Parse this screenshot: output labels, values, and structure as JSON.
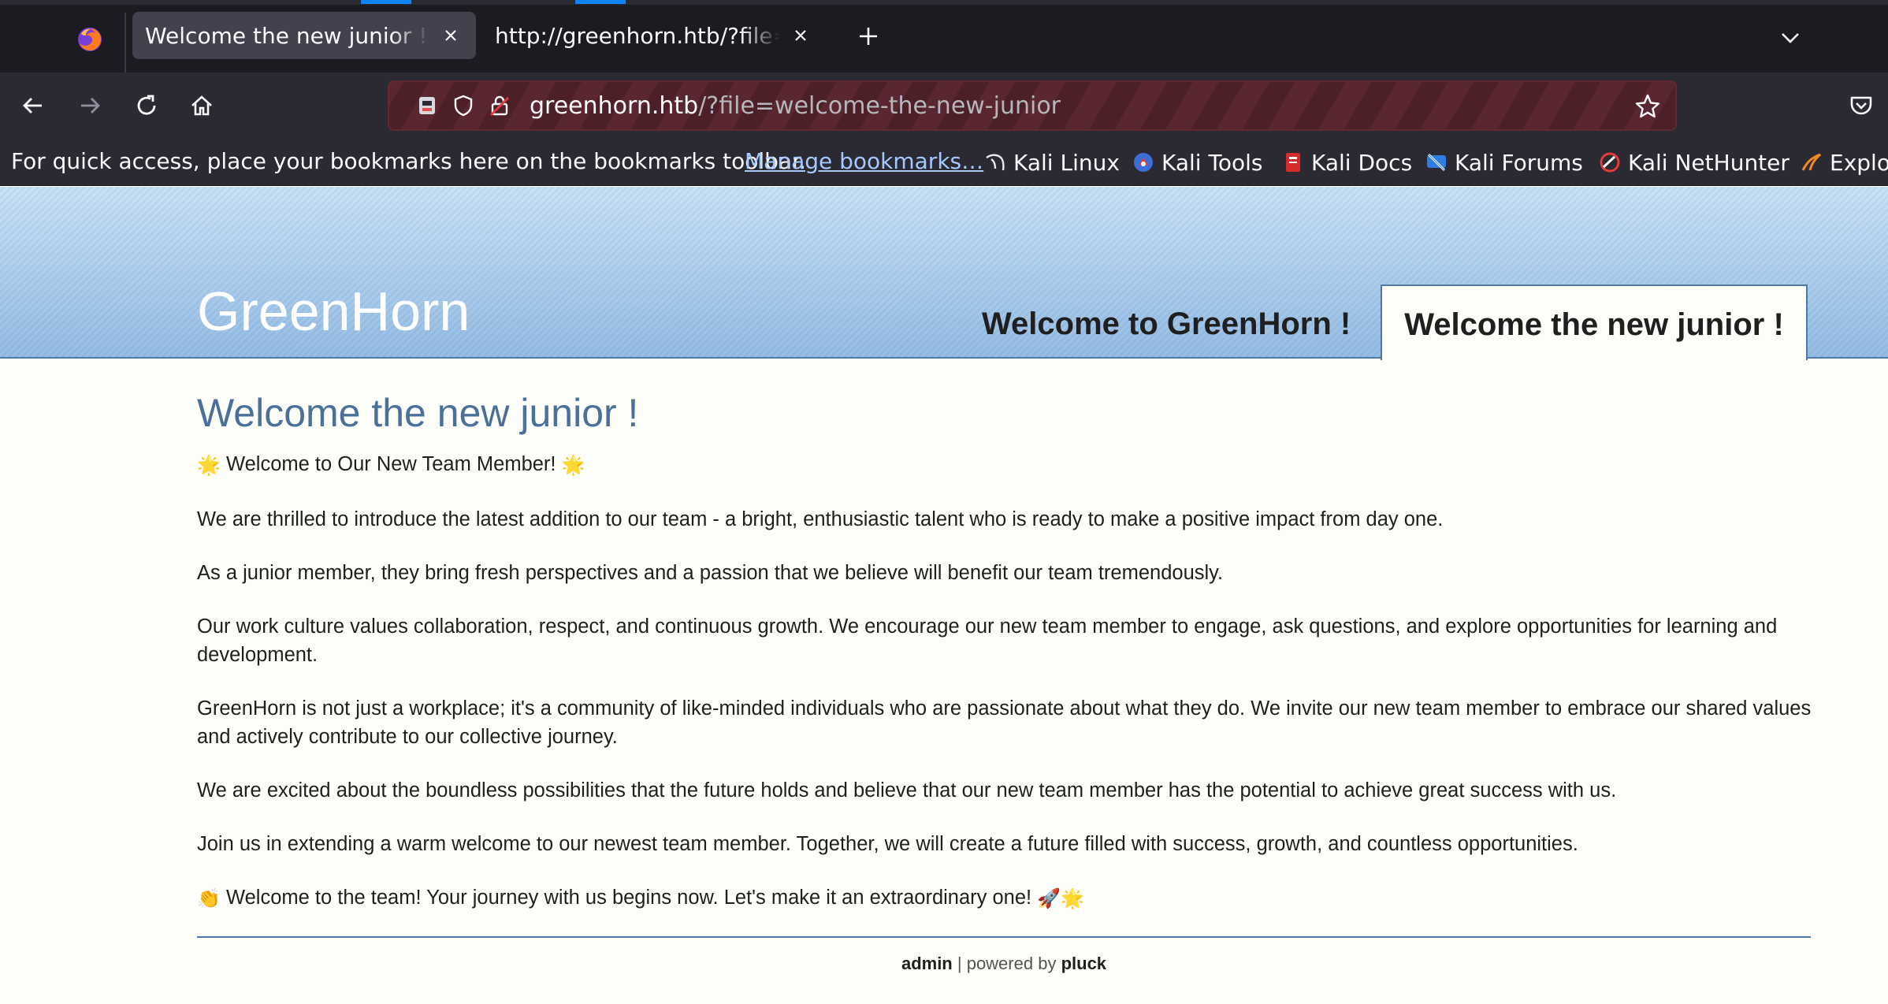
{
  "browser": {
    "tabs": [
      {
        "title": "Welcome the new junior ! - GreenHorn",
        "active": true
      },
      {
        "title": "http://greenhorn.htb/?file=welcome-the-new-junior",
        "active": false
      }
    ],
    "url_host": "greenhorn.htb",
    "url_path": "/?file=welcome-the-new-junior",
    "bookmarks_hint": "For quick access, place your bookmarks here on the bookmarks toolbar.",
    "manage_bookmarks": "Manage bookmarks…",
    "bookmarks": [
      {
        "label": "Kali Linux",
        "icon": "kali-dragon-icon"
      },
      {
        "label": "Kali Tools",
        "icon": "kali-tools-icon"
      },
      {
        "label": "Kali Docs",
        "icon": "kali-docs-icon"
      },
      {
        "label": "Kali Forums",
        "icon": "kali-forums-icon"
      },
      {
        "label": "Kali NetHunter",
        "icon": "kali-nethunter-icon"
      },
      {
        "label": "Explo",
        "icon": "exploit-db-icon"
      }
    ]
  },
  "site": {
    "title": "GreenHorn",
    "menu": [
      {
        "label": "Welcome to GreenHorn !",
        "active": false
      },
      {
        "label": "Welcome the new junior !",
        "active": true
      }
    ]
  },
  "article": {
    "heading": "Welcome the new junior !",
    "intro": "Welcome to Our New Team Member!",
    "paragraphs": [
      "We are thrilled to introduce the latest addition to our team - a bright, enthusiastic talent who is ready to make a positive impact from day one.",
      "As a junior member, they bring fresh perspectives and a passion that we believe will benefit our team tremendously.",
      "Our work culture values collaboration, respect, and continuous growth. We encourage our new team member to engage, ask questions, and explore opportunities for learning and development.",
      "GreenHorn is not just a workplace; it's a community of like-minded individuals who are passionate about what they do. We invite our new team member to embrace our shared values and actively contribute to our collective journey.",
      "We are excited about the boundless possibilities that the future holds and believe that our new team member has the potential to achieve great success with us.",
      "Join us in extending a warm welcome to our newest team member. Together, we will create a future filled with success, growth, and countless opportunities."
    ],
    "closing": "Welcome to the team! Your journey with us begins now. Let's make it an extraordinary one!"
  },
  "footer": {
    "admin_link": "admin",
    "separator": "| powered by",
    "cms_link": "pluck"
  }
}
